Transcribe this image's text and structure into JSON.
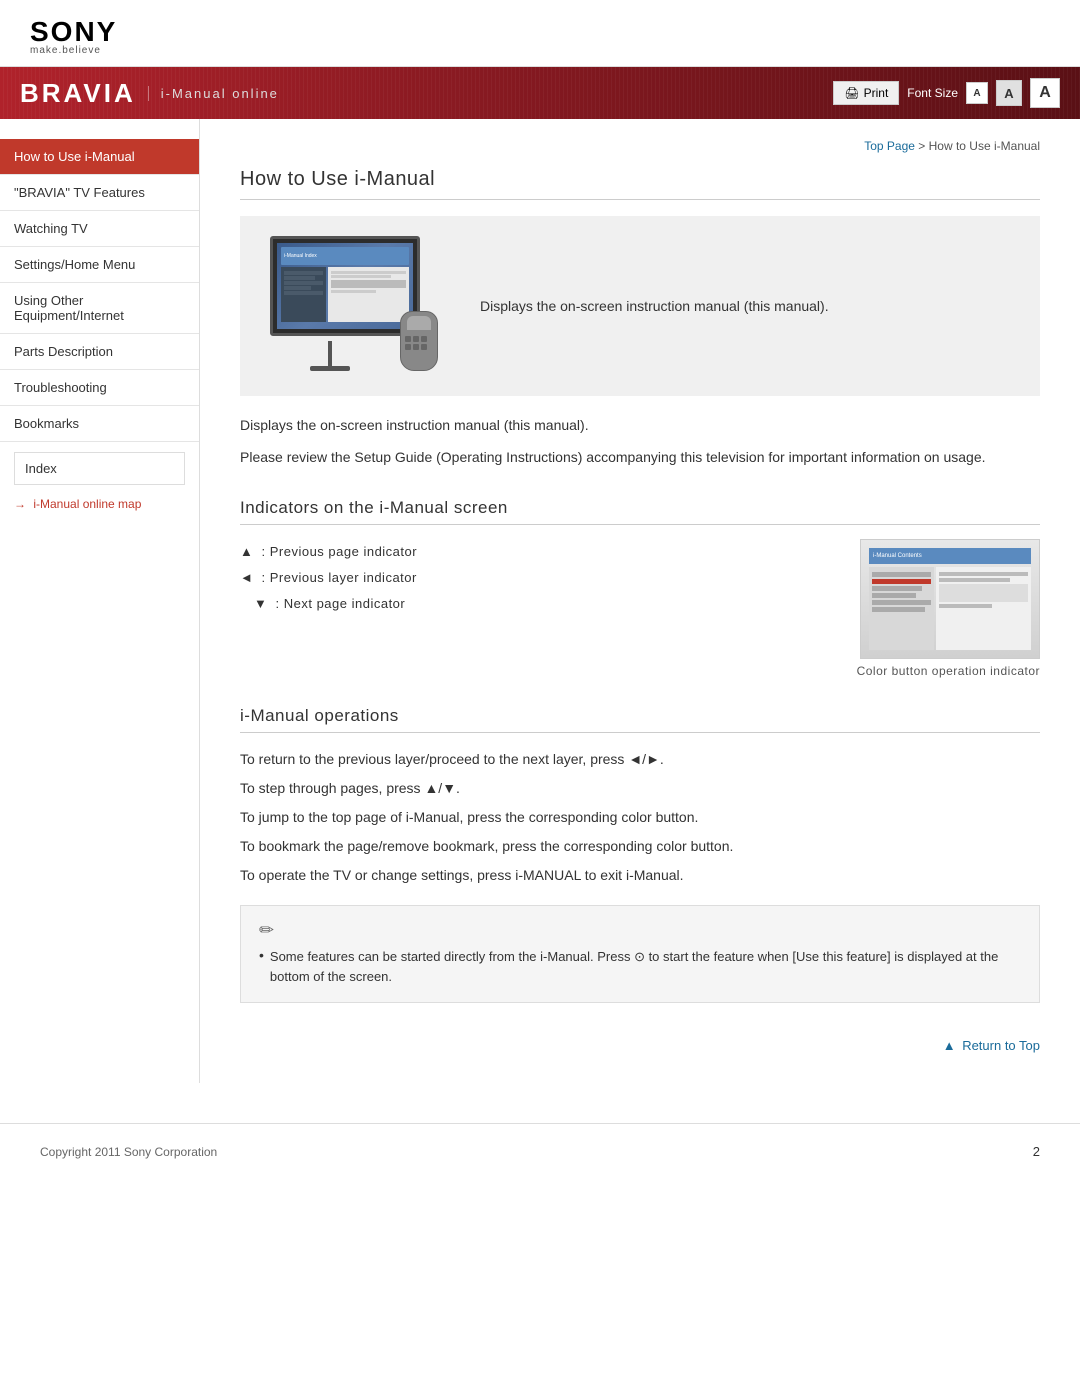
{
  "header": {
    "sony_text": "SONY",
    "tagline": "make.believe"
  },
  "banner": {
    "title": "BRAVIA",
    "subtitle": "i-Manual online",
    "print_label": "Print",
    "font_size_label": "Font Size",
    "font_small": "A",
    "font_medium": "A",
    "font_large": "A"
  },
  "sidebar": {
    "items": [
      {
        "label": "How to Use i-Manual",
        "active": true
      },
      {
        "label": "\"BRAVIA\" TV Features",
        "active": false
      },
      {
        "label": "Watching TV",
        "active": false
      },
      {
        "label": "Settings/Home Menu",
        "active": false
      },
      {
        "label": "Using Other Equipment/Internet",
        "active": false
      },
      {
        "label": "Parts Description",
        "active": false
      },
      {
        "label": "Troubleshooting",
        "active": false
      },
      {
        "label": "Bookmarks",
        "active": false
      }
    ],
    "index_label": "Index",
    "online_map_label": "i-Manual online map"
  },
  "breadcrumb": {
    "top_page": "Top Page",
    "separator": " > ",
    "current": "How to Use i-Manual"
  },
  "main": {
    "title": "How to Use i-Manual",
    "intro_text": "Displays the on-screen instruction manual (this manual).",
    "desc1": "Displays the on-screen instruction manual (this manual).",
    "desc2": "Please review the Setup Guide (Operating Instructions) accompanying this television for important information on usage.",
    "section2_title": "Indicators on the i-Manual screen",
    "indicators": [
      {
        "icon": "▲",
        "text": ": Previous page indicator"
      },
      {
        "icon": "◄",
        "text": ": Previous layer indicator"
      },
      {
        "icon": "▼",
        "text": ": Next page indicator"
      }
    ],
    "color_btn_label": "Color button operation indicator",
    "section3_title": "i-Manual operations",
    "operations": [
      "To return to the previous layer/proceed to the next layer, press ◄/►.",
      "To step through pages, press ▲/▼.",
      "To jump to the top page of i-Manual, press the corresponding color button.",
      "To bookmark the page/remove bookmark, press the corresponding color button.",
      "To operate the TV or change settings, press i-MANUAL to exit i-Manual."
    ],
    "note_text": "Some features can be started directly from the i-Manual. Press ⊙ to start the feature when [Use this feature] is displayed at the bottom of the screen."
  },
  "footer": {
    "copyright": "Copyright 2011 Sony Corporation",
    "page_number": "2",
    "return_top": "Return to Top"
  }
}
